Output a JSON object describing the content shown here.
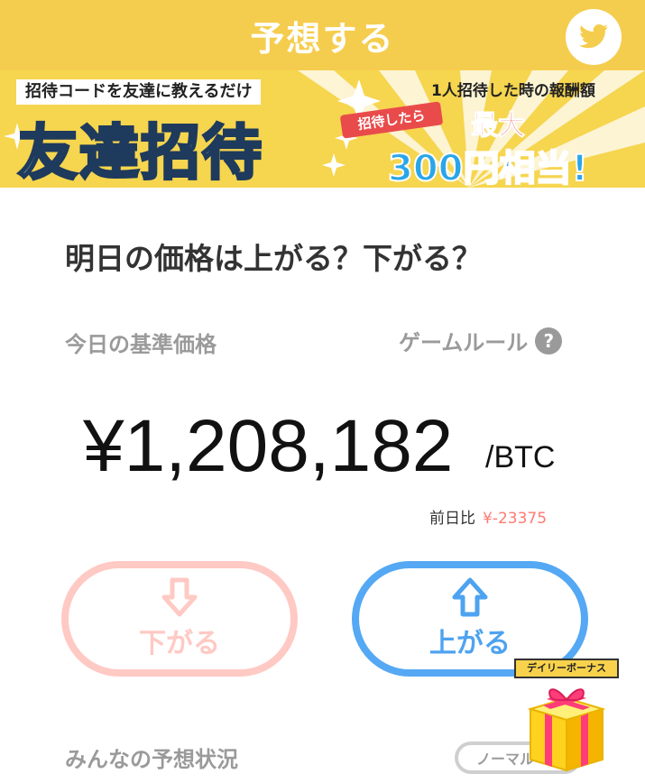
{
  "header": {
    "title": "予想する",
    "share_icon": "twitter-icon"
  },
  "banner": {
    "tag": "招待コードを友達に教えるだけ",
    "headline": "友達招待",
    "reward_caption": "1人招待した時の報酬額",
    "ribbon": "招待したら",
    "max_label": "最大",
    "amount": "300円相当!",
    "slide_count": 2,
    "active_slide": 2
  },
  "main": {
    "question": "明日の価格は上がる？下がる？",
    "base_price_label": "今日の基準価格",
    "rules_label": "ゲームルール",
    "help_icon": "question-circle-icon",
    "price": "¥1,208,182",
    "price_unit": "/BTC",
    "diff_label": "前日比",
    "diff_value": "¥-23375"
  },
  "actions": {
    "down_label": "下がる",
    "down_icon": "arrow-down-icon",
    "up_label": "上がる",
    "up_icon": "arrow-up-icon"
  },
  "bonus": {
    "label": "デイリーボーナス",
    "icon": "gift-box-icon"
  },
  "footer": {
    "everyone_label": "みんなの予想状況",
    "mode_label": "ノーマル",
    "mode_icon": "chevron-down-icon"
  },
  "colors": {
    "header_bg": "#f5cd4e",
    "down_accent": "#ffc9c4",
    "up_accent": "#55a8f3",
    "diff_negative": "#ff7a72",
    "muted_text": "#9a9a9a"
  }
}
